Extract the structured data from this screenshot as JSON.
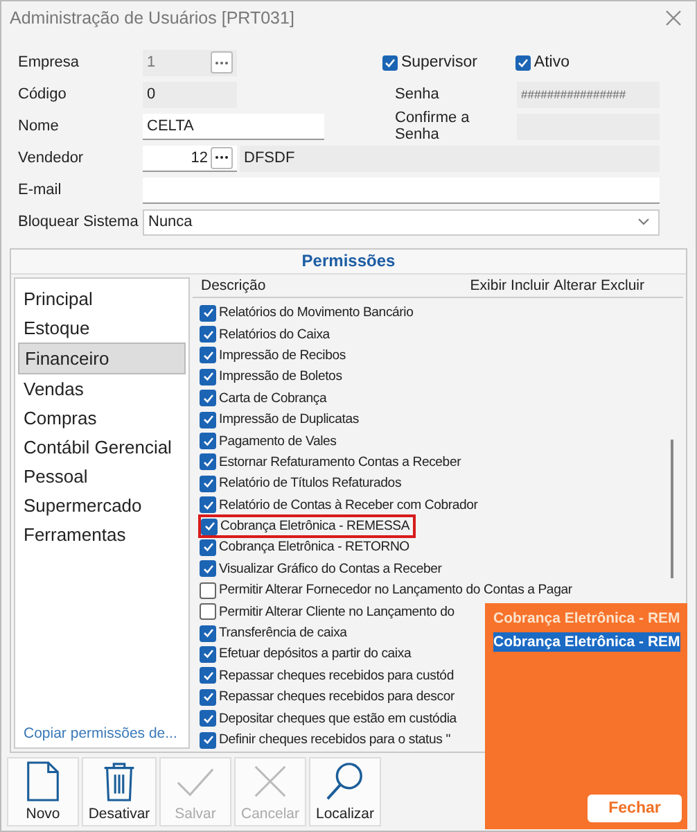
{
  "window": {
    "title": "Administração de Usuários [PRT031]"
  },
  "form": {
    "empresa": {
      "label": "Empresa",
      "value": "1"
    },
    "codigo": {
      "label": "Código",
      "value": "0"
    },
    "nome": {
      "label": "Nome",
      "value": "CELTA"
    },
    "vendedor": {
      "label": "Vendedor",
      "value": "12",
      "name": "DFSDF"
    },
    "email": {
      "label": "E-mail"
    },
    "bloquear": {
      "label": "Bloquear Sistema",
      "value": "Nunca"
    },
    "supervisor": {
      "label": "Supervisor",
      "checked": true
    },
    "ativo": {
      "label": "Ativo",
      "checked": true
    },
    "senha": {
      "label": "Senha",
      "value": "################"
    },
    "confirme": {
      "label": "Confirme a Senha"
    }
  },
  "permissions": {
    "title": "Permissões",
    "categories": [
      {
        "label": "Principal",
        "selected": false
      },
      {
        "label": "Estoque",
        "selected": false
      },
      {
        "label": "Financeiro",
        "selected": true
      },
      {
        "label": "Vendas",
        "selected": false
      },
      {
        "label": "Compras",
        "selected": false
      },
      {
        "label": "Contábil Gerencial",
        "selected": false
      },
      {
        "label": "Pessoal",
        "selected": false
      },
      {
        "label": "Supermercado",
        "selected": false
      },
      {
        "label": "Ferramentas",
        "selected": false
      }
    ],
    "copy_link": "Copiar permissões de...",
    "columns": [
      "Descrição",
      "Exibir",
      "Incluir",
      "Alterar",
      "Excluir"
    ],
    "items": [
      {
        "label": "Relatórios do Movimento Bancário",
        "checked": true,
        "highlighted": false
      },
      {
        "label": "Relatórios do Caixa",
        "checked": true,
        "highlighted": false
      },
      {
        "label": "Impressão de Recibos",
        "checked": true,
        "highlighted": false
      },
      {
        "label": "Impressão de Boletos",
        "checked": true,
        "highlighted": false
      },
      {
        "label": "Carta de Cobrança",
        "checked": true,
        "highlighted": false
      },
      {
        "label": "Impressão de Duplicatas",
        "checked": true,
        "highlighted": false
      },
      {
        "label": "Pagamento de Vales",
        "checked": true,
        "highlighted": false
      },
      {
        "label": "Estornar Refaturamento Contas a Receber",
        "checked": true,
        "highlighted": false
      },
      {
        "label": "Relatório de Títulos Refaturados",
        "checked": true,
        "highlighted": false
      },
      {
        "label": "Relatório de Contas à Receber com Cobrador",
        "checked": true,
        "highlighted": false
      },
      {
        "label": "Cobrança Eletrônica - REMESSA",
        "checked": true,
        "highlighted": true
      },
      {
        "label": "Cobrança Eletrônica - RETORNO",
        "checked": true,
        "highlighted": false
      },
      {
        "label": "Visualizar Gráfico do Contas a Receber",
        "checked": true,
        "highlighted": false
      },
      {
        "label": "Permitir Alterar Fornecedor no Lançamento do Contas a Pagar",
        "checked": false,
        "highlighted": false
      },
      {
        "label": "Permitir Alterar Cliente no Lançamento do",
        "checked": false,
        "highlighted": false
      },
      {
        "label": "Transferência de caixa",
        "checked": true,
        "highlighted": false
      },
      {
        "label": "Efetuar depósitos a partir do caixa",
        "checked": true,
        "highlighted": false
      },
      {
        "label": "Repassar cheques recebidos para custód",
        "checked": true,
        "highlighted": false
      },
      {
        "label": "Repassar cheques recebidos para descor",
        "checked": true,
        "highlighted": false
      },
      {
        "label": "Depositar cheques que estão em custódia",
        "checked": true,
        "highlighted": false
      },
      {
        "label": "Definir cheques recebidos para o status \"",
        "checked": true,
        "highlighted": false
      }
    ]
  },
  "toolbar": [
    {
      "label": "Novo",
      "kind": "file",
      "disabled": false
    },
    {
      "label": "Desativar",
      "kind": "trash",
      "disabled": false
    },
    {
      "label": "Salvar",
      "kind": "check",
      "disabled": true
    },
    {
      "label": "Cancelar",
      "kind": "cross",
      "disabled": true
    },
    {
      "label": "Localizar",
      "kind": "search",
      "disabled": false
    }
  ],
  "popup": {
    "lines": [
      {
        "text": "Cobrança Eletrônica - REM",
        "selected": false
      },
      {
        "text": "Cobrança Eletrônica - REM",
        "selected": true
      }
    ],
    "button": "Fechar"
  }
}
